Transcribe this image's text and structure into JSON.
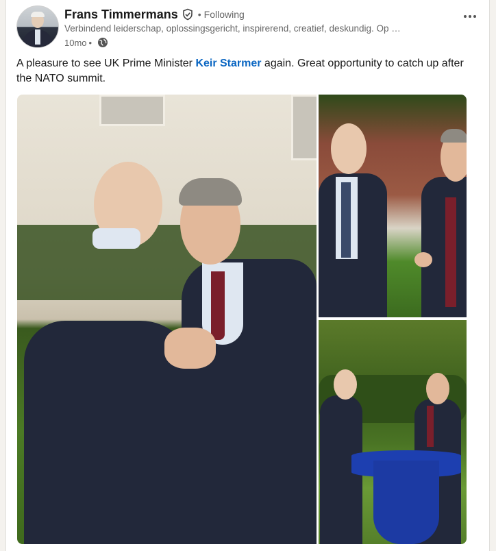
{
  "post": {
    "author": {
      "name": "Frans Timmermans",
      "follow_status": "Following",
      "headline": "Verbindend leiderschap, oplossingsgericht, inspirerend, creatief, deskundig. Op …",
      "time": "10mo",
      "visibility_icon": "globe-icon",
      "verified_icon": "verified-shield-icon"
    },
    "text_before": "A pleasure to see UK Prime Minister ",
    "mention": "Keir Starmer",
    "text_after": " again. Great opportunity to catch up after the NATO summit.",
    "more_icon": "more-options-icon",
    "photos": [
      {
        "name": "photo-handshake"
      },
      {
        "name": "photo-laughing"
      },
      {
        "name": "photo-table-conversation"
      }
    ]
  },
  "colors": {
    "link": "#0a66c2",
    "text": "#191919",
    "secondary_text": "#666666",
    "background": "#f4f2ee"
  }
}
